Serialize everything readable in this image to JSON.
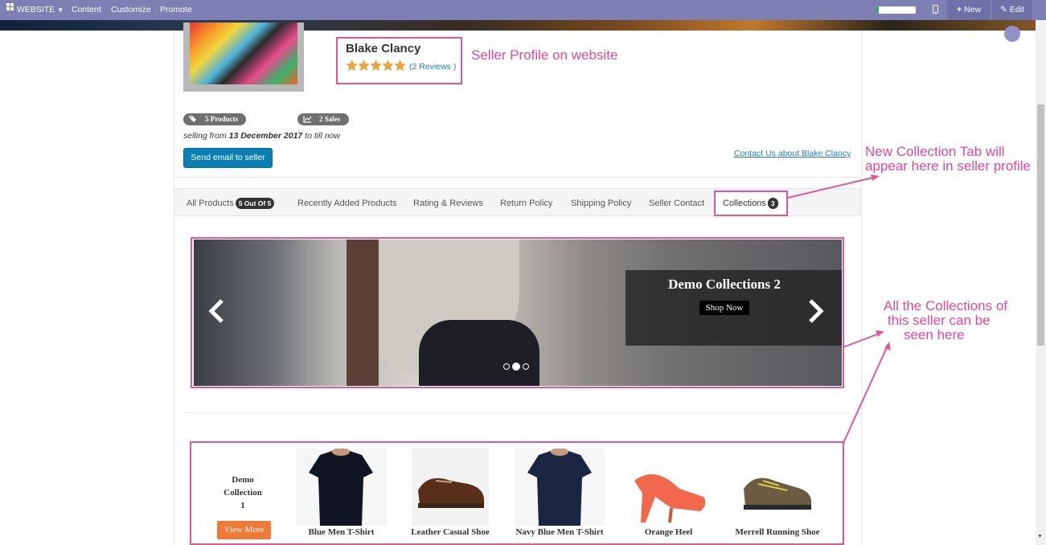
{
  "topbar": {
    "website_label": "WEBSITE",
    "menu": [
      "Content",
      "Customize",
      "Promote"
    ],
    "new_label": "New",
    "edit_label": "Edit"
  },
  "seller": {
    "name": "Blake Clancy",
    "reviews_link": "(2 Reviews )",
    "rating": 5,
    "products_badge": "5  Products",
    "sales_badge": "2  Sales",
    "selling_prefix": "selling from ",
    "selling_date": "13 December 2017",
    "selling_suffix": " to till now",
    "send_email_button": "Send email to seller",
    "contact_link": "Contact Us about Blake Clancy"
  },
  "annotations": {
    "profile": "Seller Profile on website",
    "tab_line1": "New Collection Tab will",
    "tab_line2": "appear here in seller profile",
    "collections_line1": "All the Collections of",
    "collections_line2": "this seller can be",
    "collections_line3": "seen here"
  },
  "tabs": [
    {
      "label": "All Products",
      "count": "5 Out Of 5"
    },
    {
      "label": "Recently Added Products"
    },
    {
      "label": "Rating & Reviews"
    },
    {
      "label": "Return Policy"
    },
    {
      "label": "Shipping Policy"
    },
    {
      "label": "Seller Contact"
    },
    {
      "label": "Collections",
      "count": "3"
    }
  ],
  "carousel": {
    "title": "Demo Collections 2",
    "button": "Shop Now",
    "slide_count": 3,
    "active_slide": 2
  },
  "collection": {
    "name_line1": "Demo",
    "name_line2": "Collection",
    "name_line3": "1",
    "view_more": "View More",
    "products": [
      "Blue Men T-Shirt",
      "Leather Casual Shoe",
      "Navy Blue Men T-Shirt",
      "Orange Heel",
      "Merrell Running Shoe"
    ]
  },
  "colors": {
    "accent": "#e0589a",
    "topbar": "#7d7fb5",
    "primary_button": "#0b7fb4",
    "view_more": "#f07a37"
  }
}
